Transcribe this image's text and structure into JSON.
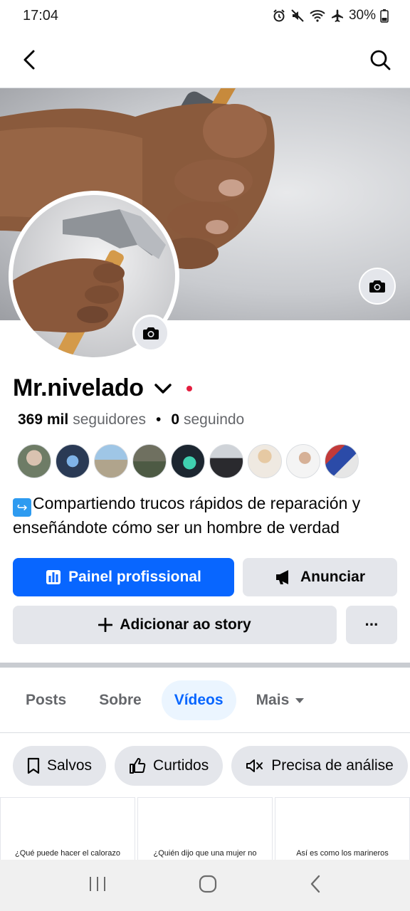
{
  "status_bar": {
    "time": "17:04",
    "battery": "30%",
    "icons": [
      "alarm-icon",
      "mute-icon",
      "wifi-icon",
      "airplane-icon",
      "battery-icon"
    ]
  },
  "nav": {
    "back_icon": "back-chevron-icon",
    "search_icon": "search-icon"
  },
  "profile": {
    "name": "Mr.nivelado",
    "followers_count": "369 mil",
    "followers_label": "seguidores",
    "separator": "•",
    "following_count": "0",
    "following_label": "seguindo",
    "bio": "Compartiendo trucos rápidos de reparación y enseñándote cómo ser un hombre de verdad",
    "bio_emoji": "↪"
  },
  "buttons": {
    "professional": "Painel profissional",
    "advertise": "Anunciar",
    "add_story": "Adicionar ao story",
    "more": "···"
  },
  "tabs": [
    {
      "label": "Posts",
      "active": false
    },
    {
      "label": "Sobre",
      "active": false
    },
    {
      "label": "Vídeos",
      "active": true
    },
    {
      "label": "Mais",
      "active": false
    }
  ],
  "chips": [
    {
      "label": "Salvos",
      "icon": "bookmark-icon"
    },
    {
      "label": "Curtidos",
      "icon": "thumbs-up-icon"
    },
    {
      "label": "Precisa de análise",
      "icon": "muted-speaker-icon"
    }
  ],
  "videos": [
    {
      "caption": "¿Qué puede hacer el calorazo"
    },
    {
      "caption": "¿Quién dijo que una mujer no"
    },
    {
      "caption": "Así es como los marineros"
    }
  ],
  "colors": {
    "primary": "#0866ff",
    "button_bg": "#e4e6eb",
    "active_tab_bg": "#ebf5ff",
    "secondary_text": "#65676b",
    "status_dot": "#e41e3f"
  }
}
